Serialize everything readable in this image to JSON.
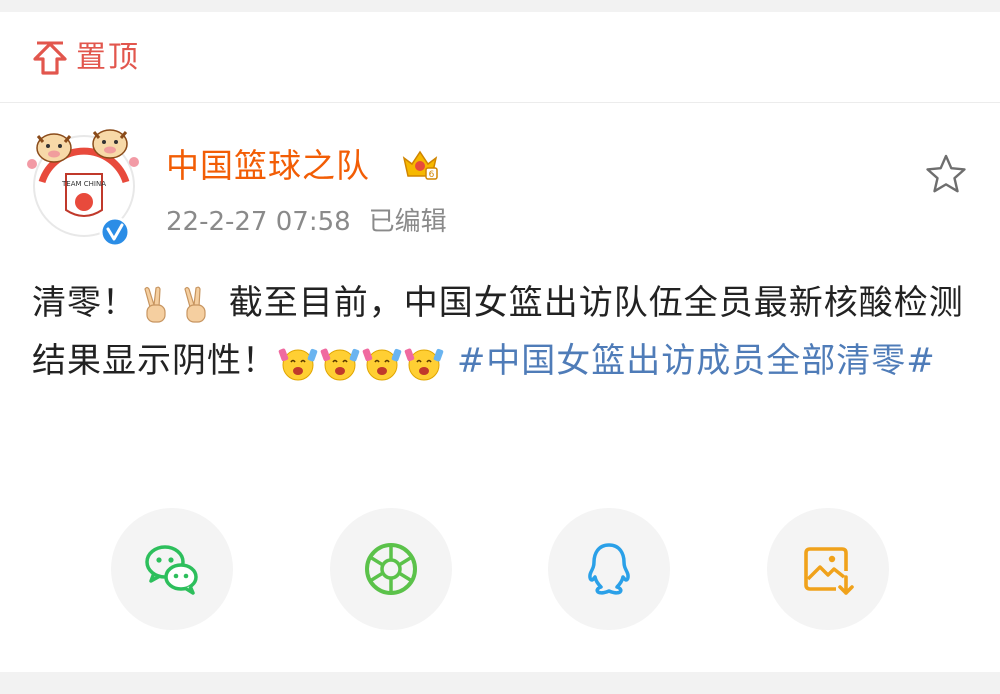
{
  "pinned": {
    "label": "置顶",
    "icon": "pin-top-icon"
  },
  "post": {
    "username": "中国篮球之队",
    "timestamp": "22-2-27 07:58",
    "edited": "已编辑",
    "text_1": "清零！",
    "text_2": " 截至目前，中国女篮出访队伍全员最新核酸检测结果显示阴性！",
    "topic": "#中国女篮出访成员全部清零#",
    "avatar_text": "TEAM CHINA"
  },
  "share": {
    "items": [
      "wechat-icon",
      "moments-icon",
      "qq-icon",
      "save-image-icon"
    ]
  },
  "colors": {
    "username": "#f25d05",
    "topic": "#4f7cb8",
    "pin": "#e2564d",
    "wechat": "#2dbf5c",
    "moments": "#5bc24a",
    "qq": "#2aa0e8",
    "save": "#f0a21b"
  }
}
